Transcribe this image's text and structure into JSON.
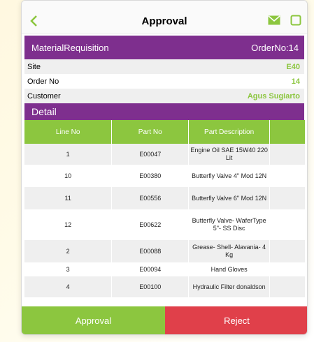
{
  "nav": {
    "title": "Approval",
    "accent": "#8cc63f"
  },
  "header": {
    "left": "MaterialRequisition",
    "right": "OrderNo:14",
    "color": "#7e2f8e"
  },
  "info": [
    {
      "label": "Site",
      "value": "E40"
    },
    {
      "label": "Order No",
      "value": "14"
    },
    {
      "label": "Customer",
      "value": "Agus Sugiarto"
    }
  ],
  "detail": {
    "title": "Detail",
    "columns": [
      "Line No",
      "Part No",
      "Part Description",
      ""
    ],
    "rows": [
      {
        "line": "1",
        "part": "E00047",
        "desc": "Engine Oil SAE 15W40 220 Lit"
      },
      {
        "line": "10",
        "part": "E00380",
        "desc": "Butterfly Valve 4\" Mod 12N"
      },
      {
        "line": "11",
        "part": "E00556",
        "desc": "Butterfly Valve 6\" Mod 12N"
      },
      {
        "line": "12",
        "part": "E00622",
        "desc": "Butterfly Valve- WaferType 5\"- SS Disc"
      },
      {
        "line": "2",
        "part": "E00088",
        "desc": "Grease- Shell- Alavania- 4 Kg"
      },
      {
        "line": "3",
        "part": "E00094",
        "desc": "Hand Gloves"
      },
      {
        "line": "4",
        "part": "E00100",
        "desc": "Hydraulic Filter donaldson"
      }
    ]
  },
  "actions": {
    "approve": "Approval",
    "reject": "Reject"
  },
  "icons": {
    "back": "back-chevron-icon",
    "mail": "mail-icon",
    "checkbox": "checkbox-icon"
  }
}
